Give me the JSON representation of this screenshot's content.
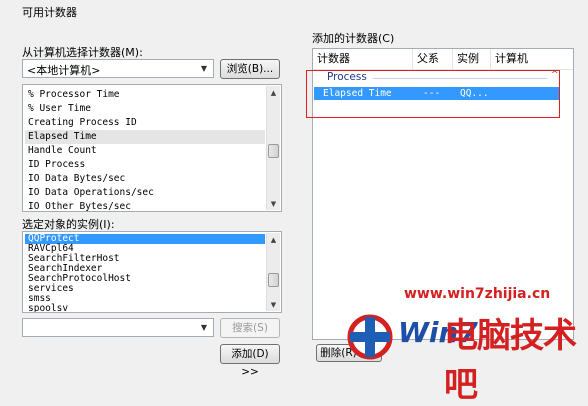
{
  "left": {
    "available_title": "可用计数器",
    "from_computer_label": "从计算机选择计数器(M):",
    "computer_value": "<本地计算机>",
    "browse_label": "浏览(B)...",
    "counters": [
      "% Processor Time",
      "% User Time",
      "Creating Process ID",
      "Elapsed Time",
      "Handle Count",
      "ID Process",
      "IO Data Bytes/sec",
      "IO Data Operations/sec",
      "IO Other Bytes/sec"
    ],
    "instances_label": "选定对象的实例(I):",
    "instances": [
      "QQProtect",
      "RAVCpl64",
      "SearchFilterHost",
      "SearchIndexer",
      "SearchProtocolHost",
      "services",
      "smss",
      "spoolsv"
    ],
    "search_label": "搜索(S)",
    "add_label": "添加(D) >>"
  },
  "right": {
    "added_title": "添加的计数器(C)",
    "columns": [
      "计数器",
      "父系",
      "实例",
      "计算机"
    ],
    "group": "Process",
    "row": {
      "counter": "Elapsed Time",
      "parent": "---",
      "instance": "QQ...",
      "computer": ""
    },
    "delete_label": "删除(R) <<"
  },
  "watermark": {
    "url": "www.win7zhijia.cn",
    "brand": "电脑技术吧",
    "logo": "Win7"
  },
  "colors": {
    "selection": "#3399ff",
    "highlight_box": "#e02020",
    "watermark": "#d42020"
  }
}
